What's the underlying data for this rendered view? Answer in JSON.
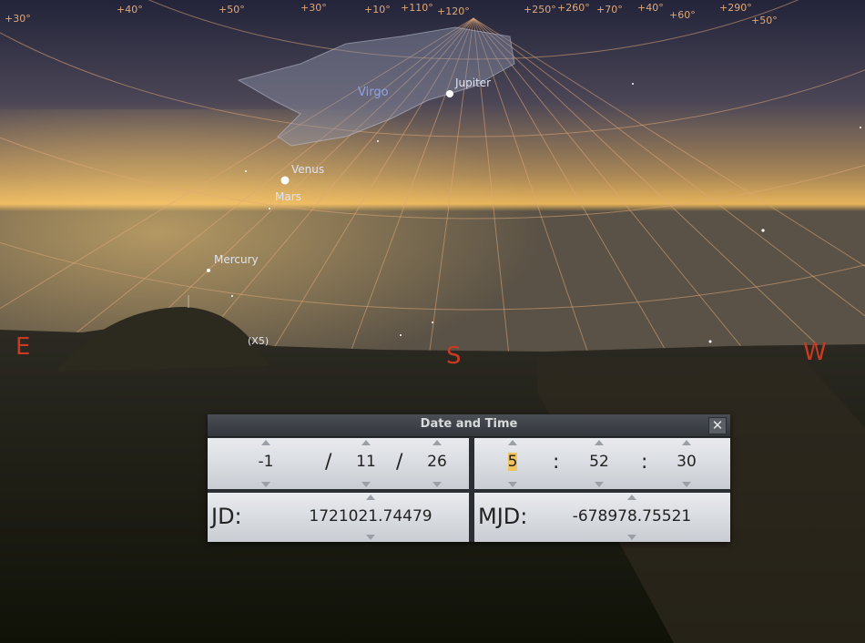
{
  "sky": {
    "constellation": "Virgo",
    "planets": [
      "Jupiter",
      "Venus",
      "Mars",
      "Mercury"
    ],
    "mercury_magnifier": "(X5)",
    "cardinals": {
      "east": "E",
      "south": "S",
      "west": "W"
    },
    "grid_labels": [
      "+40°",
      "+50°",
      "+30°",
      "+10°",
      "+110°",
      "+120°",
      "+250°",
      "+260°",
      "+70°",
      "+40°",
      "+60°",
      "+290°",
      "+50°",
      "+30°"
    ],
    "colors": {
      "cardinal": "#c93a22",
      "grid": "#e0a878",
      "planet_label": "#dfe3f0",
      "constellation_label": "#8fa3e0"
    }
  },
  "dialog": {
    "title": "Date and Time",
    "close_icon": "close-icon",
    "date": {
      "year": "-1",
      "month": "11",
      "day": "26",
      "separator": "/"
    },
    "time": {
      "hour": "5",
      "minute": "52",
      "second": "30",
      "separator": ":"
    },
    "jd": {
      "label": "JD:",
      "value": "1721021.74479"
    },
    "mjd": {
      "label": "MJD:",
      "value": "-678978.75521"
    }
  }
}
